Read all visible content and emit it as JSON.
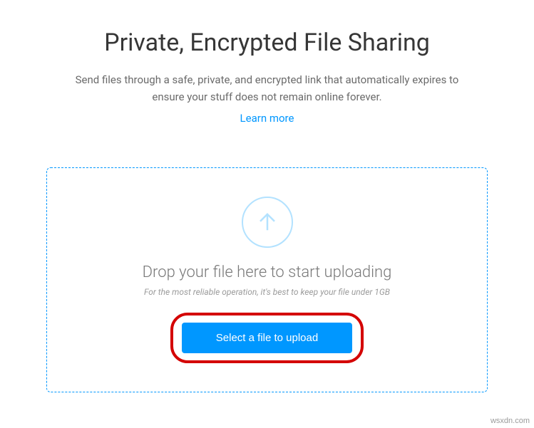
{
  "header": {
    "title": "Private, Encrypted File Sharing",
    "subtitle": "Send files through a safe, private, and encrypted link that automatically expires to ensure your stuff does not remain online forever.",
    "learn_more": "Learn more"
  },
  "dropzone": {
    "title": "Drop your file here to start uploading",
    "hint": "For the most reliable operation, it's best to keep your file under 1GB",
    "button": "Select a file to upload"
  },
  "watermark": "wsxdn.com"
}
